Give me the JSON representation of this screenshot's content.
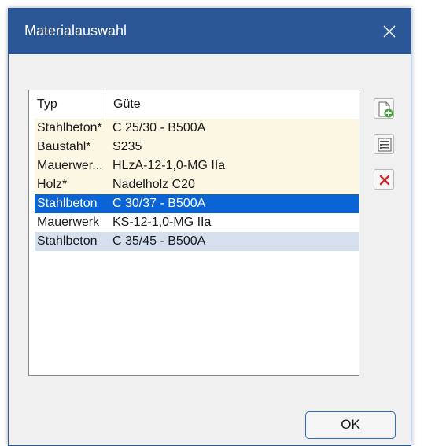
{
  "window": {
    "title": "Materialauswahl"
  },
  "list": {
    "columns": [
      "Typ",
      "Güte"
    ],
    "rows": [
      {
        "typ": "Stahlbeton*",
        "guete": "C 25/30 - B500A",
        "state": "tint"
      },
      {
        "typ": "Baustahl*",
        "guete": "S235",
        "state": "tint"
      },
      {
        "typ": "Mauerwer...",
        "guete": "HLzA-12-1,0-MG IIa",
        "state": "tint"
      },
      {
        "typ": "Holz*",
        "guete": "Nadelholz C20",
        "state": "tint"
      },
      {
        "typ": "Stahlbeton",
        "guete": "C 30/37 - B500A",
        "state": "selected"
      },
      {
        "typ": "Mauerwerk",
        "guete": "KS-12-1,0-MG IIa",
        "state": "plain"
      },
      {
        "typ": "Stahlbeton",
        "guete": "C 35/45 - B500A",
        "state": "alt"
      }
    ]
  },
  "toolbar": {
    "icons": [
      "add-material-icon",
      "edit-properties-icon",
      "delete-icon"
    ]
  },
  "footer": {
    "ok_label": "OK"
  },
  "colors": {
    "titlebar": "#2b5797",
    "selected_row": "#0a64d6",
    "tint_row": "#fcf7e3",
    "alt_row": "#d5e0ef",
    "ok_border": "#2b6cc9"
  }
}
